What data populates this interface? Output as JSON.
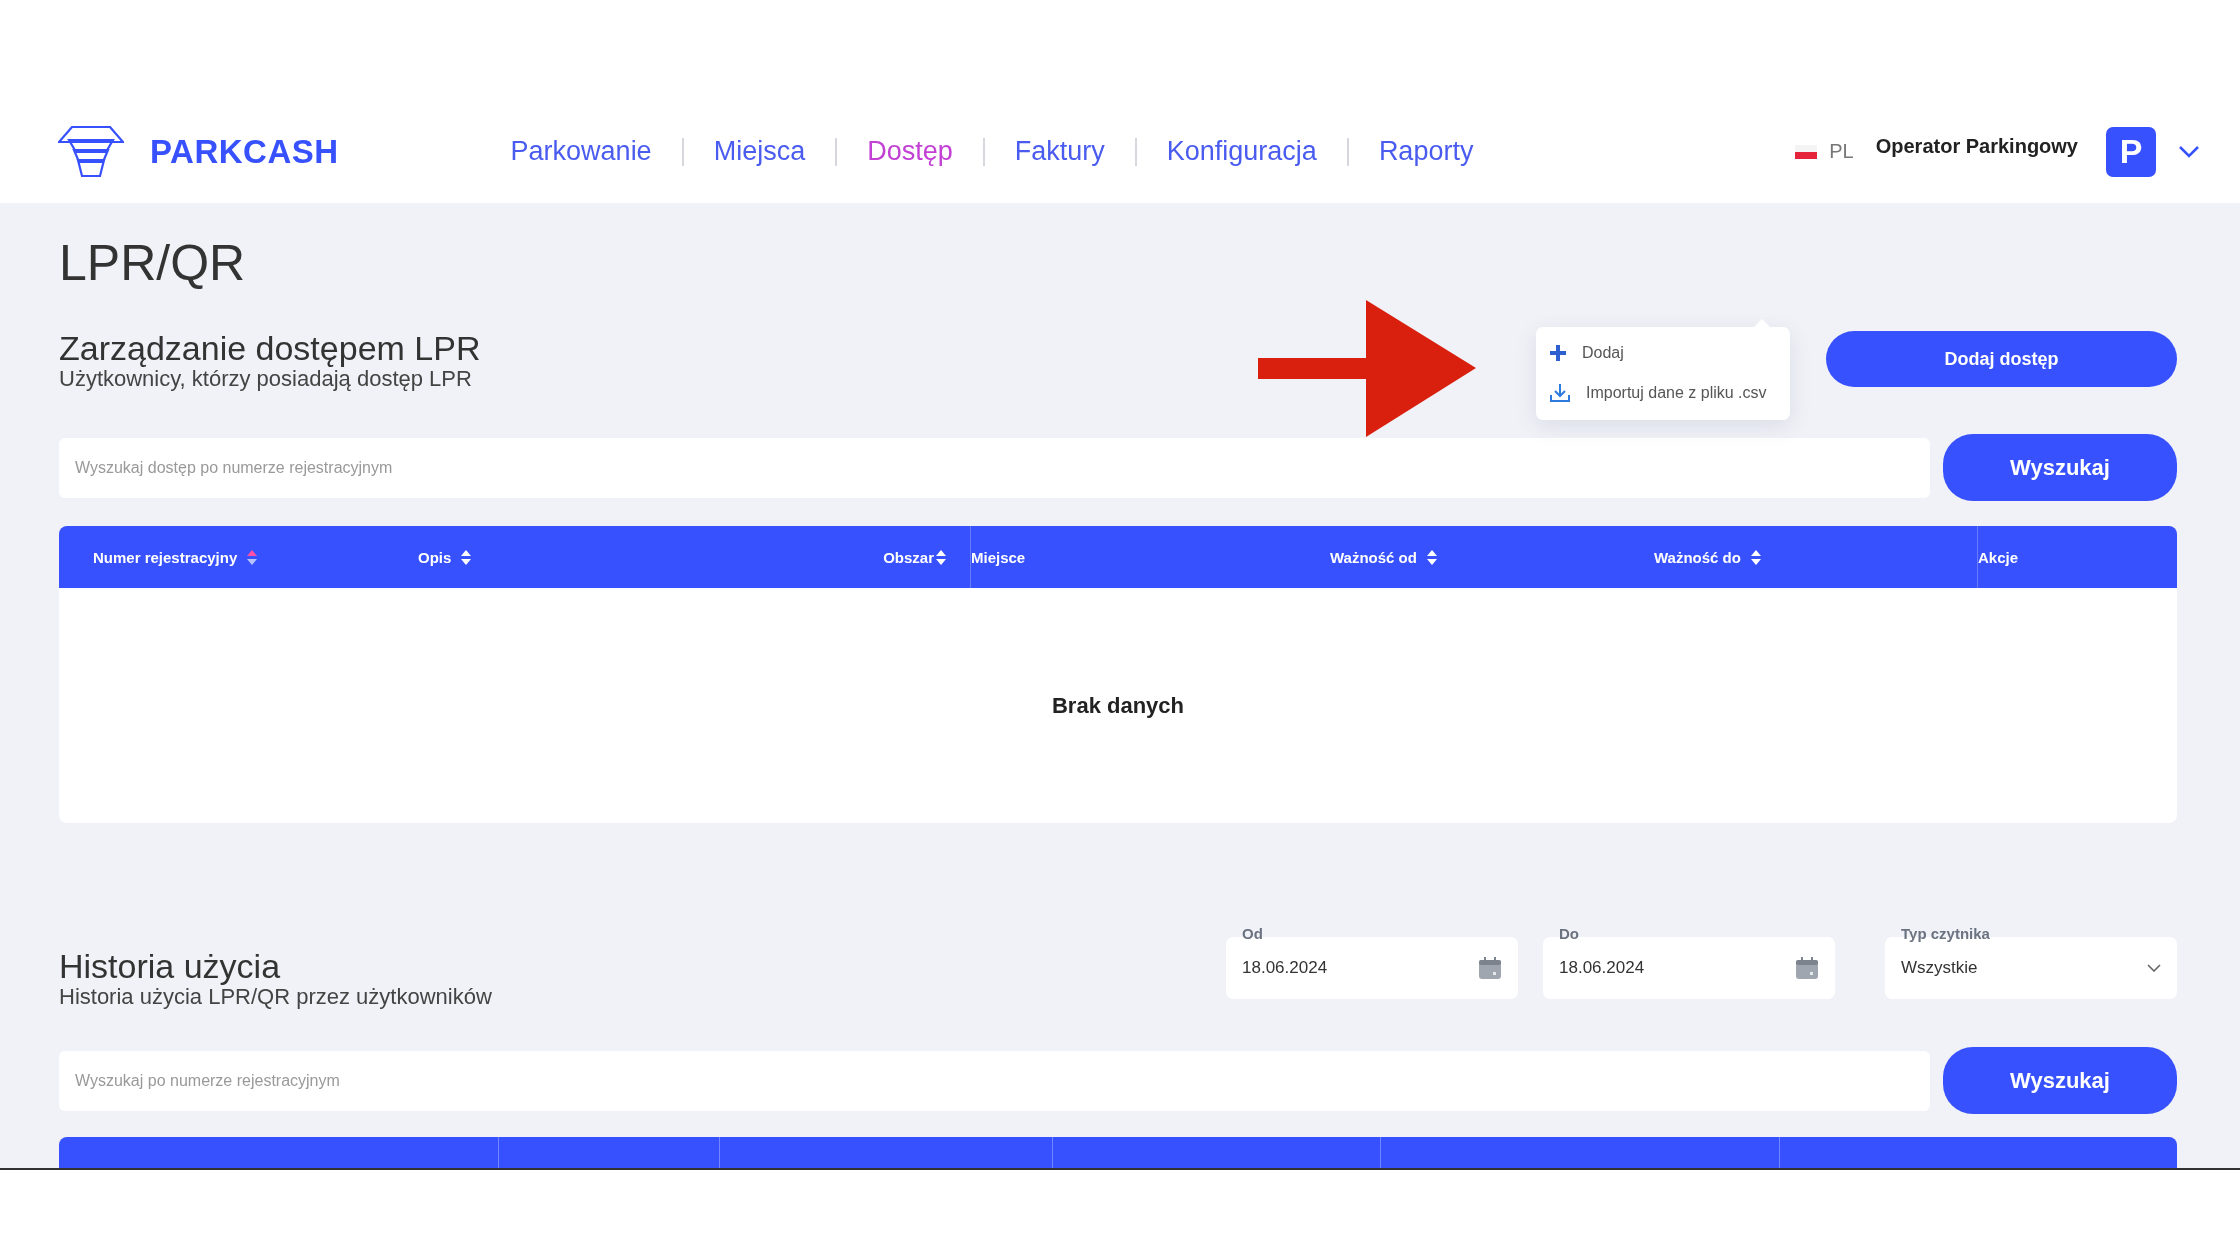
{
  "header": {
    "logo": "PARKCASH",
    "nav": [
      {
        "label": "Parkowanie",
        "selected": false
      },
      {
        "label": "Miejsca",
        "selected": false
      },
      {
        "label": "Dostęp",
        "selected": true
      },
      {
        "label": "Faktury",
        "selected": false
      },
      {
        "label": "Konfiguracja",
        "selected": false
      },
      {
        "label": "Raporty",
        "selected": false
      }
    ],
    "language": "PL",
    "user": "Operator Parkingowy",
    "avatar": "P"
  },
  "page_title": "LPR/QR",
  "access": {
    "title": "Zarządzanie dostępem LPR",
    "subtitle": "Użytkownicy, którzy posiadają dostęp LPR",
    "menu": [
      {
        "kind": "add",
        "label": "Dodaj"
      },
      {
        "kind": "import",
        "label": "Importuj dane z pliku .csv"
      }
    ],
    "add_button": "Dodaj dostęp",
    "search": {
      "placeholder": "Wyszukaj dostęp po numerze rejestracyjnym"
    },
    "search_button": "Wyszukaj",
    "table": {
      "columns": [
        {
          "label": "Numer rejestracyjny",
          "sortable": true,
          "sorted": true
        },
        {
          "label": "Opis",
          "sortable": true,
          "sorted": false
        },
        {
          "label": "Obszar",
          "sortable": true,
          "sorted": false
        },
        {
          "label": "Miejsce",
          "sortable": false
        },
        {
          "label": "Ważność od",
          "sortable": true,
          "sorted": false
        },
        {
          "label": "Ważność do",
          "sortable": true,
          "sorted": false
        },
        {
          "label": "Akcje",
          "sortable": false
        }
      ],
      "empty": "Brak danych"
    }
  },
  "history": {
    "title": "Historia użycia",
    "subtitle": "Historia użycia LPR/QR przez użytkowników",
    "filters": [
      {
        "kind": "date",
        "label": "Od",
        "value": "18.06.2024"
      },
      {
        "kind": "date",
        "label": "Do",
        "value": "18.06.2024"
      },
      {
        "kind": "select",
        "label": "Typ czytnika",
        "value": "Wszystkie"
      }
    ],
    "search": {
      "placeholder": "Wyszukaj po numerze rejestracyjnym"
    },
    "search_button": "Wyszukaj"
  }
}
